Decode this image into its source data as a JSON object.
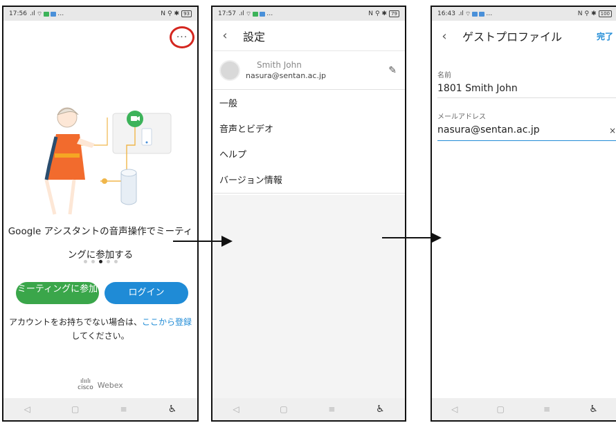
{
  "screen1": {
    "status": {
      "time": "17:56",
      "battery": "93"
    },
    "more_label": "···",
    "promo_text": "Google アシスタントの音声操作でミーティングに参加する",
    "join_button": "ミーティングに参加",
    "login_button": "ログイン",
    "signup_text": "アカウントをお持ちでない場合は、",
    "signup_link": "ここから登録",
    "signup_suffix": "してください。",
    "brand_logo": "cisco",
    "brand_name": "Webex",
    "carousel_active_index": 2
  },
  "screen2": {
    "status": {
      "time": "17:57",
      "battery": "79"
    },
    "title": "設定",
    "profile_name": "Smith John",
    "profile_email": "nasura@sentan.ac.jp",
    "menu_items": [
      "一般",
      "音声とビデオ",
      "ヘルプ",
      "バージョン情報"
    ]
  },
  "screen3": {
    "status": {
      "time": "16:43",
      "battery": "100"
    },
    "title": "ゲストプロファイル",
    "done_label": "完了",
    "name_label": "名前",
    "name_value": "1801 Smith John",
    "email_label": "メールアドレス",
    "email_value": "nasura@sentan.ac.jp"
  },
  "colors": {
    "highlight_circle": "#d4261f",
    "accent_blue": "#1f8bd6",
    "join_green": "#3aa64a"
  }
}
